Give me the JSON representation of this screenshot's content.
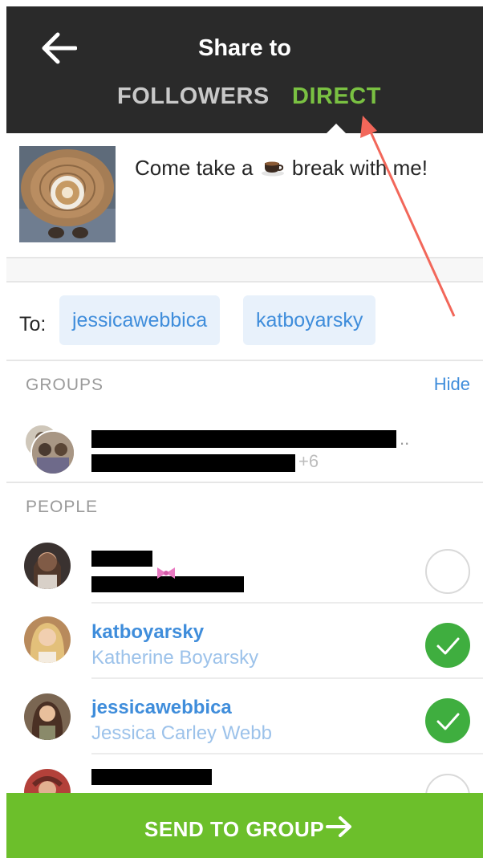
{
  "header": {
    "title": "Share to",
    "tabs": [
      {
        "label": "FOLLOWERS",
        "active": false
      },
      {
        "label": "DIRECT",
        "active": true
      }
    ]
  },
  "post": {
    "caption_before": "Come take a",
    "caption_after": "break with me!"
  },
  "recipients": {
    "to_label": "To:",
    "chips": [
      "jessicawebbica",
      "katboyarsky"
    ]
  },
  "groups": {
    "header": "GROUPS",
    "hide_label": "Hide",
    "group": {
      "extra_count": "+6",
      "ellipsis": ".."
    }
  },
  "people": {
    "header": "PEOPLE",
    "list": [
      {
        "username": "",
        "full_name": "",
        "selected": false
      },
      {
        "username": "katboyarsky",
        "full_name": "Katherine Boyarsky",
        "selected": true
      },
      {
        "username": "jessicawebbica",
        "full_name": "Jessica Carley Webb",
        "selected": true
      },
      {
        "username": "",
        "full_name": "",
        "selected": false
      }
    ]
  },
  "send_button": {
    "label": "SEND TO GROUP"
  },
  "colors": {
    "accent_green": "#7ac142",
    "link_blue": "#3f8ddb",
    "send_green": "#6cbf2b",
    "annotation_red": "#f2675a",
    "header_bg": "#2a2a2a"
  }
}
